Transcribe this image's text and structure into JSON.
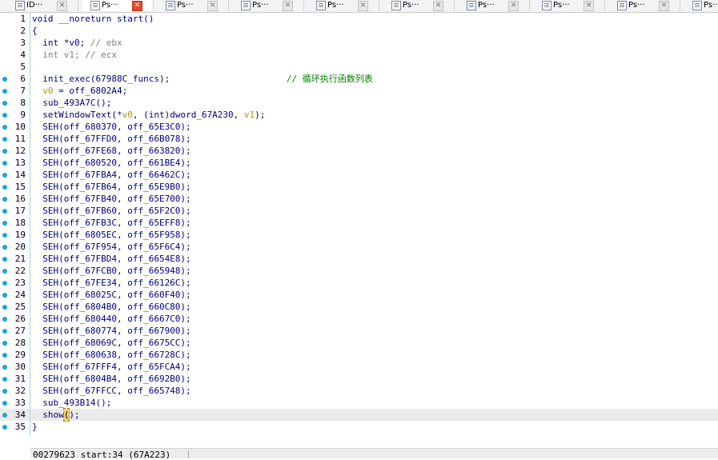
{
  "tabs": [
    {
      "label": "ID···",
      "close": "✕",
      "active": false,
      "close_style": "gray"
    },
    {
      "label": "Ps···",
      "close": "✕",
      "active": true,
      "close_style": "red"
    },
    {
      "label": "Ps···",
      "close": "✕",
      "active": false,
      "close_style": "gray"
    },
    {
      "label": "Ps···",
      "close": "✕",
      "active": false,
      "close_style": "gray"
    },
    {
      "label": "Ps···",
      "close": "✕",
      "active": false,
      "close_style": "gray"
    },
    {
      "label": "Ps···",
      "close": "✕",
      "active": false,
      "close_style": "gray"
    },
    {
      "label": "Ps···",
      "close": "✕",
      "active": false,
      "close_style": "gray"
    },
    {
      "label": "Ps···",
      "close": "✕",
      "active": false,
      "close_style": "gray"
    },
    {
      "label": "Ps···",
      "close": "✕",
      "active": false,
      "close_style": "gray"
    },
    {
      "label": "Ps···",
      "close": "",
      "active": false,
      "close_style": "gray"
    }
  ],
  "colors": {
    "keyword": "#0000ff",
    "comment": "#7f7f7f",
    "comment_cn": "#008000",
    "variable": "#a0a000",
    "breakpoint_dot": "#19a3e0",
    "current_line": "#eaeaea",
    "close_active": "#e24a2b"
  },
  "code": {
    "current_line": 34,
    "lines": [
      {
        "num": "1",
        "dot": false,
        "segments": [
          {
            "text": "void __noreturn start()",
            "cls": "n"
          }
        ]
      },
      {
        "num": "2",
        "dot": false,
        "segments": [
          {
            "text": "{",
            "cls": "n"
          }
        ]
      },
      {
        "num": "3",
        "dot": false,
        "segments": [
          {
            "text": "  int *v0; ",
            "cls": "n"
          },
          {
            "text": "// ebx",
            "cls": "c"
          }
        ]
      },
      {
        "num": "4",
        "dot": false,
        "segments": [
          {
            "text": "  int v1; ",
            "cls": "c"
          },
          {
            "text": "// ecx",
            "cls": "c"
          }
        ]
      },
      {
        "num": "5",
        "dot": false,
        "segments": [
          {
            "text": "",
            "cls": "n"
          }
        ]
      },
      {
        "num": "6",
        "dot": true,
        "segments": [
          {
            "text": "  init_exec(67988C_funcs);                      ",
            "cls": "n"
          },
          {
            "text": "// 循环执行函数列表",
            "cls": "cg"
          }
        ]
      },
      {
        "num": "7",
        "dot": true,
        "segments": [
          {
            "text": "  v0",
            "cls": "v"
          },
          {
            "text": " = off_6802A4;",
            "cls": "n"
          }
        ]
      },
      {
        "num": "8",
        "dot": true,
        "segments": [
          {
            "text": "  sub_493A7C();",
            "cls": "n"
          }
        ]
      },
      {
        "num": "9",
        "dot": true,
        "segments": [
          {
            "text": "  setWindowText(*",
            "cls": "n"
          },
          {
            "text": "v0",
            "cls": "v"
          },
          {
            "text": ", (int)dword_67A230, ",
            "cls": "n"
          },
          {
            "text": "v1",
            "cls": "v"
          },
          {
            "text": ");",
            "cls": "n"
          }
        ]
      },
      {
        "num": "10",
        "dot": true,
        "segments": [
          {
            "text": "  SEH(off_680370, off_65E3C0);",
            "cls": "n"
          }
        ]
      },
      {
        "num": "11",
        "dot": true,
        "segments": [
          {
            "text": "  SEH(off_67FFD0, off_66B078);",
            "cls": "n"
          }
        ]
      },
      {
        "num": "12",
        "dot": true,
        "segments": [
          {
            "text": "  SEH(off_67FE68, off_663820);",
            "cls": "n"
          }
        ]
      },
      {
        "num": "13",
        "dot": true,
        "segments": [
          {
            "text": "  SEH(off_680520, off_661BE4);",
            "cls": "n"
          }
        ]
      },
      {
        "num": "14",
        "dot": true,
        "segments": [
          {
            "text": "  SEH(off_67FBA4, off_66462C);",
            "cls": "n"
          }
        ]
      },
      {
        "num": "15",
        "dot": true,
        "segments": [
          {
            "text": "  SEH(off_67FB64, off_65E9B0);",
            "cls": "n"
          }
        ]
      },
      {
        "num": "16",
        "dot": true,
        "segments": [
          {
            "text": "  SEH(off_67FB40, off_65E700);",
            "cls": "n"
          }
        ]
      },
      {
        "num": "17",
        "dot": true,
        "segments": [
          {
            "text": "  SEH(off_67FB60, off_65F2C0);",
            "cls": "n"
          }
        ]
      },
      {
        "num": "18",
        "dot": true,
        "segments": [
          {
            "text": "  SEH(off_67FB3C, off_65EFF8);",
            "cls": "n"
          }
        ]
      },
      {
        "num": "19",
        "dot": true,
        "segments": [
          {
            "text": "  SEH(off_6805EC, off_65F958);",
            "cls": "n"
          }
        ]
      },
      {
        "num": "20",
        "dot": true,
        "segments": [
          {
            "text": "  SEH(off_67F954, off_65F6C4);",
            "cls": "n"
          }
        ]
      },
      {
        "num": "21",
        "dot": true,
        "segments": [
          {
            "text": "  SEH(off_67FBD4, off_6654E8);",
            "cls": "n"
          }
        ]
      },
      {
        "num": "22",
        "dot": true,
        "segments": [
          {
            "text": "  SEH(off_67FCB0, off_665948);",
            "cls": "n"
          }
        ]
      },
      {
        "num": "23",
        "dot": true,
        "segments": [
          {
            "text": "  SEH(off_67FE34, off_66126C);",
            "cls": "n"
          }
        ]
      },
      {
        "num": "24",
        "dot": true,
        "segments": [
          {
            "text": "  SEH(off_68025C, off_660F40);",
            "cls": "n"
          }
        ]
      },
      {
        "num": "25",
        "dot": true,
        "segments": [
          {
            "text": "  SEH(off_6804B0, off_660C80);",
            "cls": "n"
          }
        ]
      },
      {
        "num": "26",
        "dot": true,
        "segments": [
          {
            "text": "  SEH(off_680440, off_6667C0);",
            "cls": "n"
          }
        ]
      },
      {
        "num": "27",
        "dot": true,
        "segments": [
          {
            "text": "  SEH(off_680774, off_667900);",
            "cls": "n"
          }
        ]
      },
      {
        "num": "28",
        "dot": true,
        "segments": [
          {
            "text": "  SEH(off_68069C, off_6675CC);",
            "cls": "n"
          }
        ]
      },
      {
        "num": "29",
        "dot": true,
        "segments": [
          {
            "text": "  SEH(off_680638, off_66728C);",
            "cls": "n"
          }
        ]
      },
      {
        "num": "30",
        "dot": true,
        "segments": [
          {
            "text": "  SEH(off_67FFF4, off_65FCA4);",
            "cls": "n"
          }
        ]
      },
      {
        "num": "31",
        "dot": true,
        "segments": [
          {
            "text": "  SEH(off_6804B4, off_6692B0);",
            "cls": "n"
          }
        ]
      },
      {
        "num": "32",
        "dot": true,
        "segments": [
          {
            "text": "  SEH(off_67FFCC, off_665748);",
            "cls": "n"
          }
        ]
      },
      {
        "num": "33",
        "dot": true,
        "segments": [
          {
            "text": "  sub_493B14();",
            "cls": "n"
          }
        ]
      },
      {
        "num": "34",
        "dot": true,
        "segments": [
          {
            "text": "  show",
            "cls": "n"
          },
          {
            "text": "(",
            "cls": "caret"
          },
          {
            "text": ");",
            "cls": "n"
          }
        ]
      },
      {
        "num": "35",
        "dot": true,
        "segments": [
          {
            "text": "}",
            "cls": "n"
          }
        ]
      }
    ]
  },
  "status": {
    "text": "00279623 start:34 (67A223)"
  }
}
